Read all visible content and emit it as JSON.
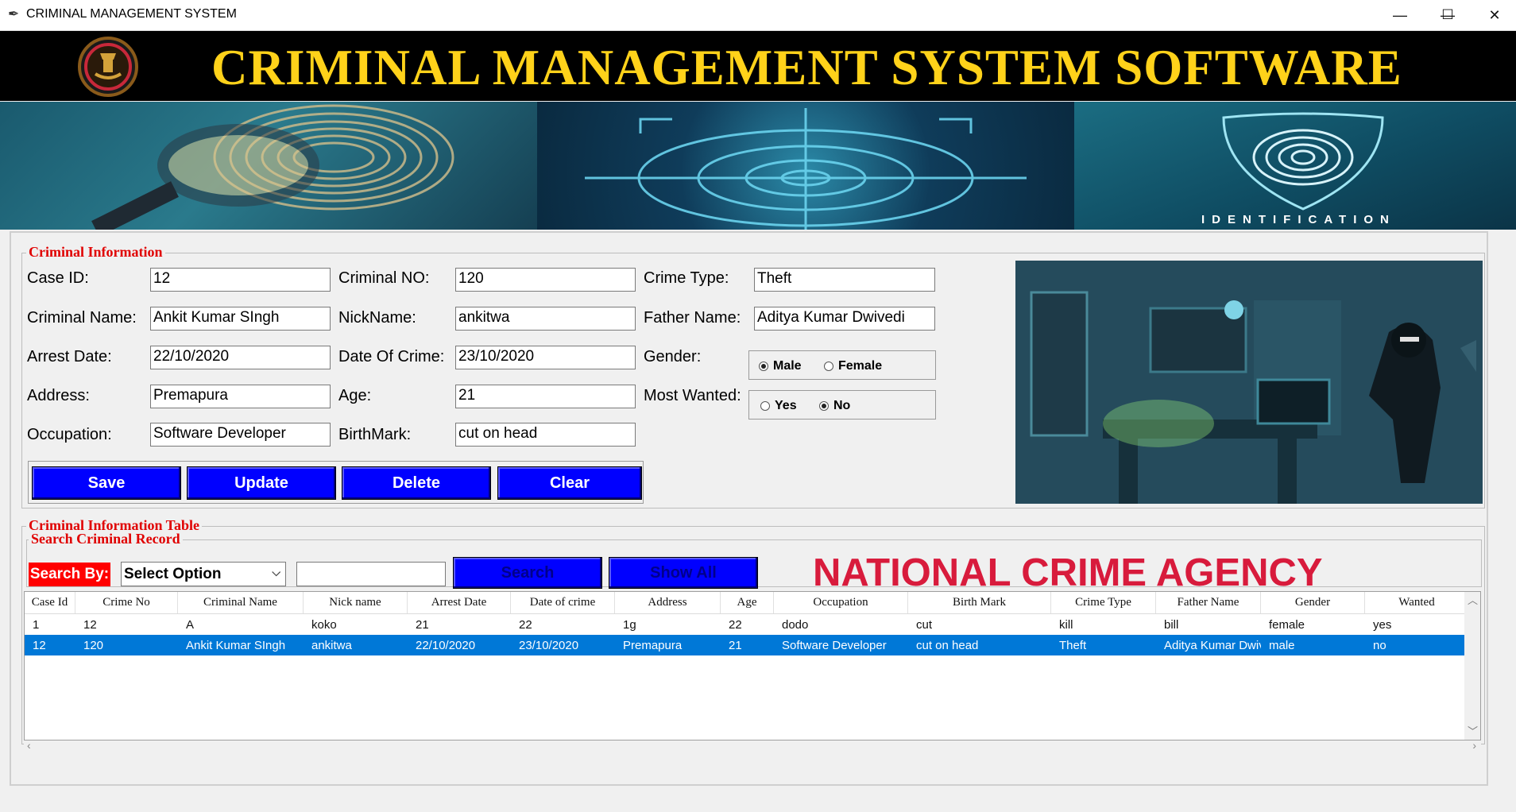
{
  "window": {
    "title": "CRIMINAL MANAGEMENT SYSTEM",
    "minimize": "—",
    "maximize": "☐",
    "close": "✕"
  },
  "banner": {
    "title": "CRIMINAL MANAGEMENT SYSTEM SOFTWARE",
    "identification_text": "IDENTIFICATION"
  },
  "criminal_info": {
    "legend": "Criminal Information",
    "fields": {
      "case_id": {
        "label": "Case ID:",
        "value": "12"
      },
      "criminal_no": {
        "label": "Criminal NO:",
        "value": "120"
      },
      "crime_type": {
        "label": "Crime Type:",
        "value": "Theft"
      },
      "criminal_name": {
        "label": "Criminal Name:",
        "value": "Ankit Kumar SIngh"
      },
      "nickname": {
        "label": "NickName:",
        "value": "ankitwa"
      },
      "father_name": {
        "label": "Father Name:",
        "value": "Aditya Kumar Dwivedi"
      },
      "arrest_date": {
        "label": "Arrest Date:",
        "value": "22/10/2020"
      },
      "date_of_crime": {
        "label": "Date Of Crime:",
        "value": "23/10/2020"
      },
      "gender": {
        "label": "Gender:"
      },
      "address": {
        "label": "Address:",
        "value": "Premapura"
      },
      "age": {
        "label": "Age:",
        "value": "21"
      },
      "most_wanted": {
        "label": "Most Wanted:"
      },
      "occupation": {
        "label": "Occupation:",
        "value": "Software Developer"
      },
      "birthmark": {
        "label": "BirthMark:",
        "value": "cut on head"
      }
    },
    "gender_options": {
      "male": "Male",
      "female": "Female",
      "selected": "Male"
    },
    "wanted_options": {
      "yes": "Yes",
      "no": "No",
      "selected": "No"
    },
    "buttons": {
      "save": "Save",
      "update": "Update",
      "delete": "Delete",
      "clear": "Clear"
    }
  },
  "table_section": {
    "legend": "Criminal Information Table",
    "search_legend": "Search Criminal Record",
    "search_by_label": "Search By:",
    "search_select_value": "Select Option",
    "search_input_value": "",
    "search_button": "Search",
    "show_all_button": "Show All",
    "agency_title": "NATIONAL CRIME AGENCY"
  },
  "table": {
    "columns": [
      "Case Id",
      "Crime No",
      "Criminal Name",
      "Nick name",
      "Arrest Date",
      "Date of crime",
      "Address",
      "Age",
      "Occupation",
      "Birth Mark",
      "Crime Type",
      "Father Name",
      "Gender",
      "Wanted"
    ],
    "rows": [
      [
        "1",
        "12",
        "A",
        "koko",
        "21",
        "22",
        "1g",
        "22",
        "dodo",
        "cut",
        "kill",
        "bill",
        "female",
        "yes"
      ],
      [
        "12",
        "120",
        "Ankit Kumar SIngh",
        "ankitwa",
        "22/10/2020",
        "23/10/2020",
        "Premapura",
        "21",
        "Software Developer",
        "cut on head",
        "Theft",
        "Aditya Kumar Dwivedi",
        "male",
        "no"
      ]
    ],
    "selected_row": 1
  },
  "colors": {
    "banner_bg": "#000000",
    "banner_title": "#ffd21a",
    "legend": "#e00000",
    "button_bg": "#0000ff",
    "selection": "#0078d7",
    "agency_title": "#d81b3c"
  }
}
